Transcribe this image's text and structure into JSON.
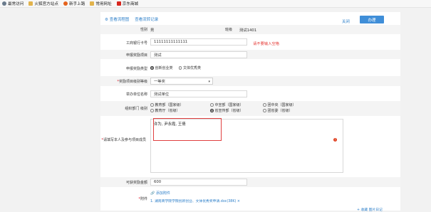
{
  "bookmarks": [
    {
      "label": "最常访问",
      "icon": "gear-icon"
    },
    {
      "label": "火狐官方站点",
      "icon": "folder-icon"
    },
    {
      "label": "新手上路",
      "icon": "firefox-icon"
    },
    {
      "label": "常用网址",
      "icon": "folder-icon"
    },
    {
      "label": "京东商城",
      "icon": "jd-icon"
    }
  ],
  "toolbar": {
    "flow_chart": "查看流程图",
    "flow_record": "查看流转记录",
    "close": "关闭",
    "submit": "办理"
  },
  "form": {
    "name_label": "性别",
    "name_value": "男",
    "class_label": "班级",
    "class_value": "测试1401",
    "card_label": "工商银行卡号",
    "card_value": "11111111111111",
    "card_warning": "请不要输入空格",
    "project_label": "申报奖励项目",
    "project_value": "测试",
    "type_label": "申报奖励类型",
    "type_options": [
      "创新创业类",
      "文体优秀类"
    ],
    "level_label": "奖励项目级别等级",
    "level_value": "一等奖",
    "org_label": "举办单位名称",
    "org_value": "测试单位",
    "dept_label": "组织部门 级别",
    "dept_options": [
      "教育部（国家级）",
      "中宣部（国家级）",
      "团中央（国家级）",
      "教育厅（省级）",
      "省宣传部（省级）",
      "团省委（省级）"
    ],
    "members_label": "请填写本人及参与项目成员",
    "members_value": "许为, 尹永霞, 王倩",
    "amount_label": "可获奖励金额",
    "amount_value": "600",
    "material_label": "附件",
    "attach_link": "添加附件",
    "attach_file": "1.  湖南商学院学院创新创业、文体优秀奖申请.doc(38K) ×",
    "footer_link": "+ 收藏 图片日记"
  }
}
